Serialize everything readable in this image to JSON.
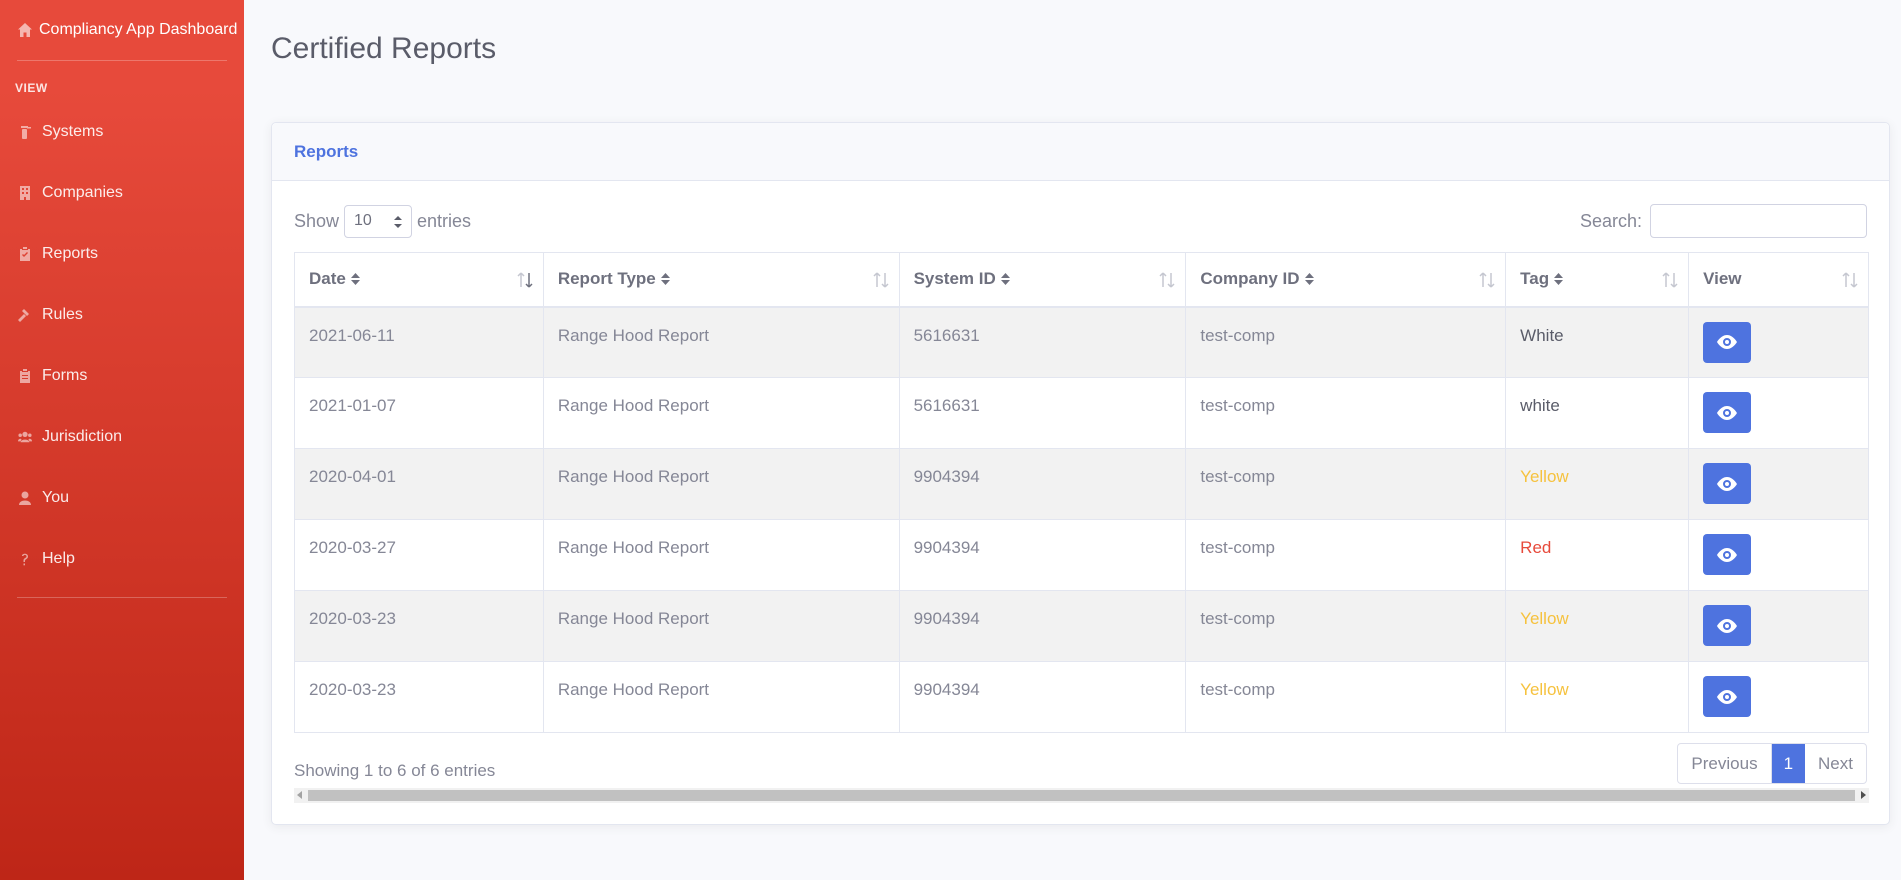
{
  "sidebar": {
    "brand": "Compliancy App Dashboard",
    "heading": "VIEW",
    "items": [
      {
        "label": "Systems",
        "icon": "fire-extinguisher-icon"
      },
      {
        "label": "Companies",
        "icon": "building-icon"
      },
      {
        "label": "Reports",
        "icon": "clipboard-icon"
      },
      {
        "label": "Rules",
        "icon": "gavel-icon"
      },
      {
        "label": "Forms",
        "icon": "clipboard-list-icon"
      },
      {
        "label": "Jurisdiction",
        "icon": "users-icon"
      },
      {
        "label": "You",
        "icon": "user-icon"
      },
      {
        "label": "Help",
        "icon": "question-icon"
      }
    ]
  },
  "page": {
    "title": "Certified Reports"
  },
  "card": {
    "header": "Reports",
    "show_label": "Show",
    "entries_label": "entries",
    "page_size": "10",
    "search_label": "Search:",
    "search_value": ""
  },
  "table": {
    "columns": [
      "Date",
      "Report Type",
      "System ID",
      "Company ID",
      "Tag",
      "View"
    ],
    "rows": [
      {
        "date": "2021-06-11",
        "report_type": "Range Hood Report",
        "system_id": "5616631",
        "company_id": "test-comp",
        "tag": "White"
      },
      {
        "date": "2021-01-07",
        "report_type": "Range Hood Report",
        "system_id": "5616631",
        "company_id": "test-comp",
        "tag": "white"
      },
      {
        "date": "2020-04-01",
        "report_type": "Range Hood Report",
        "system_id": "9904394",
        "company_id": "test-comp",
        "tag": "Yellow"
      },
      {
        "date": "2020-03-27",
        "report_type": "Range Hood Report",
        "system_id": "9904394",
        "company_id": "test-comp",
        "tag": "Red"
      },
      {
        "date": "2020-03-23",
        "report_type": "Range Hood Report",
        "system_id": "9904394",
        "company_id": "test-comp",
        "tag": "Yellow"
      },
      {
        "date": "2020-03-23",
        "report_type": "Range Hood Report",
        "system_id": "9904394",
        "company_id": "test-comp",
        "tag": "Yellow"
      }
    ]
  },
  "footer": {
    "info": "Showing 1 to 6 of 6 entries",
    "previous": "Previous",
    "current_page": "1",
    "next": "Next"
  },
  "colors": {
    "sidebar_top": "#e74a3b",
    "sidebar_bottom": "#be2617",
    "primary": "#4e73df",
    "tag_yellow": "#f6c23e",
    "tag_red": "#e74a3b"
  }
}
